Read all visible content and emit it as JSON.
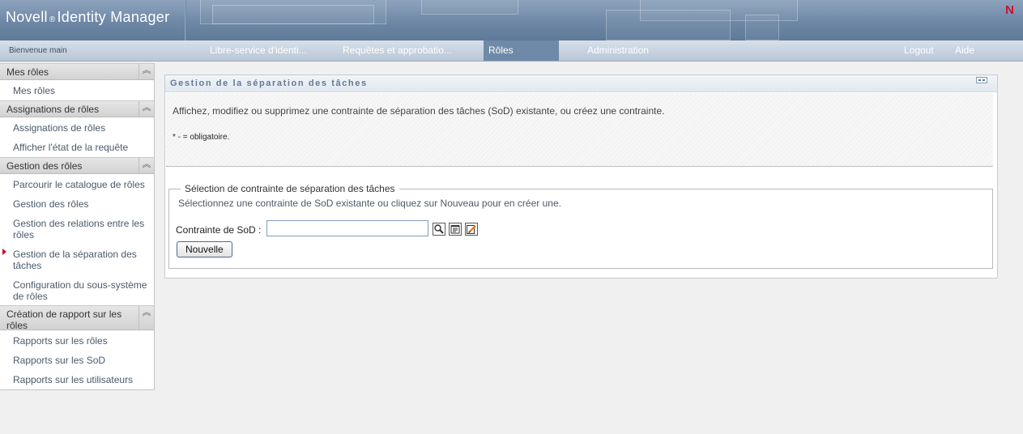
{
  "banner": {
    "product_name": "Novell",
    "registered_mark": "®",
    "product_suffix": "Identity Manager",
    "logo_letter": "N"
  },
  "navbar": {
    "welcome": "Bienvenue main",
    "tabs": [
      {
        "label": "Libre-service d'identi..."
      },
      {
        "label": "Requêtes et approbatio..."
      },
      {
        "label": "Rôles",
        "active": true
      },
      {
        "label": "Administration"
      }
    ],
    "logout_label": "Logout",
    "help_label": "Aide",
    "active_tab_color": "#6f8aa8"
  },
  "sidebar": {
    "sections": [
      {
        "title": "Mes rôles",
        "items": [
          "Mes rôles"
        ]
      },
      {
        "title": "Assignations de rôles",
        "items": [
          "Assignations de rôles",
          "Afficher l'état de la requête"
        ]
      },
      {
        "title": "Gestion des rôles",
        "items": [
          "Parcourir le catalogue de rôles",
          "Gestion des rôles",
          "Gestion des relations entre les rôles",
          "Gestion de la séparation des tâches",
          "Configuration du sous-système de rôles"
        ]
      },
      {
        "title": "Création de rapport sur les rôles",
        "items": [
          "Rapports sur les rôles",
          "Rapports sur les SoD",
          "Rapports sur les utilisateurs"
        ]
      }
    ],
    "active_item": "Gestion de la séparation des tâches",
    "collapse_icon": "double-chevron-up-icon"
  },
  "main": {
    "panel_title": "Gestion de la séparation des tâches",
    "description": "Affichez, modifiez ou supprimez une contrainte de séparation des tâches (SoD) existante, ou créez une contrainte.",
    "required_note": "* - = obligatoire.",
    "fieldset": {
      "legend": "Sélection de contrainte de séparation des tâches",
      "hint": "Sélectionnez une contrainte de SoD existante ou cliquez sur Nouveau pour en créer une.",
      "field_label": "Contrainte de SoD :",
      "field_value": "",
      "icons": [
        "magnifier-icon",
        "history-icon",
        "edit-icon"
      ],
      "new_button_label": "Nouvelle"
    }
  }
}
